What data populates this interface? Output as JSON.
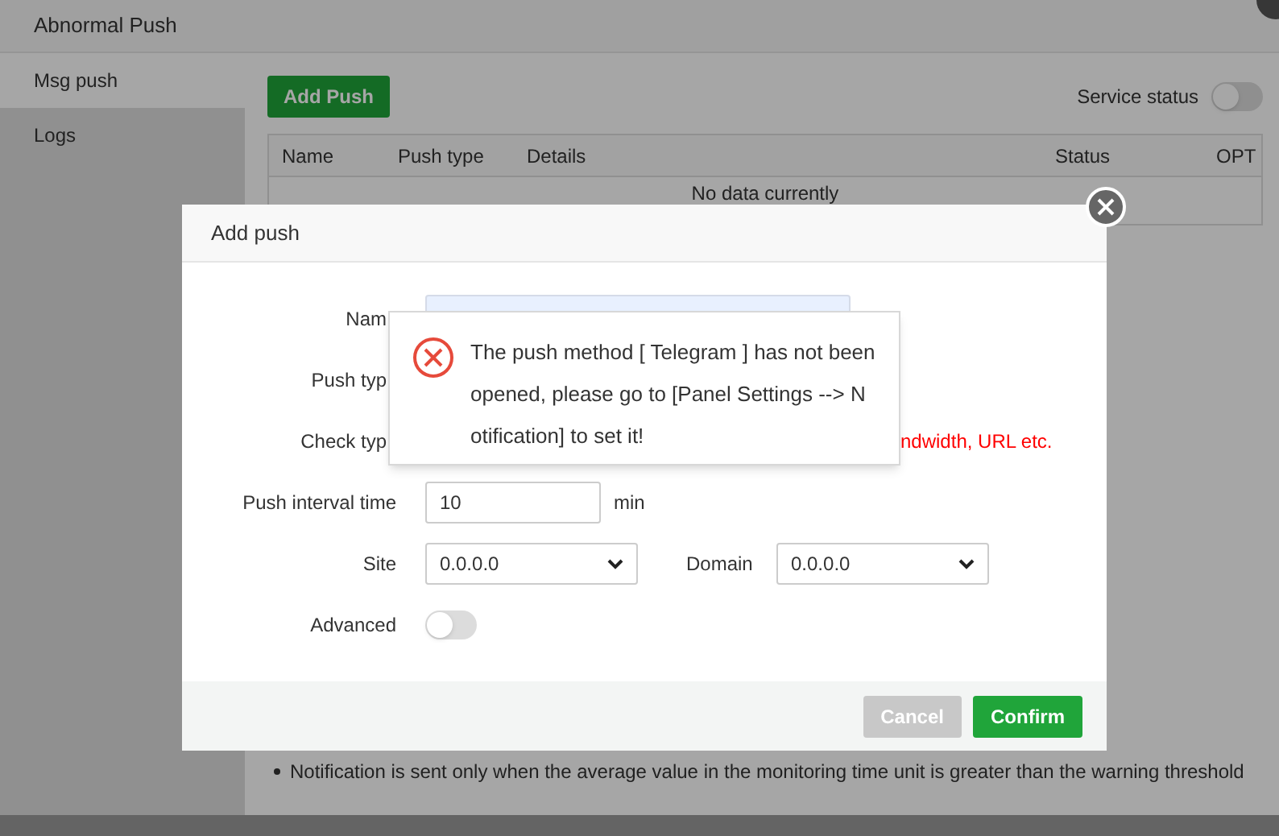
{
  "window": {
    "title": "Abnormal Push"
  },
  "sidebar": {
    "items": [
      {
        "label": "Msg push",
        "selected": true
      },
      {
        "label": "Logs",
        "selected": false
      }
    ]
  },
  "toolbar": {
    "add_button": "Add Push",
    "service_status": {
      "label": "Service status",
      "on": false
    }
  },
  "table": {
    "columns": [
      "Name",
      "Push type",
      "Details",
      "Status",
      "OPT"
    ],
    "empty_text": "No data currently"
  },
  "note": "Notification is sent only when the average value in the monitoring time unit is greater than the warning threshold",
  "dialog": {
    "title": "Add push",
    "rows": [
      {
        "kind": "input",
        "label": "Nam",
        "value": ""
      },
      {
        "kind": "label",
        "label": "Push typ"
      },
      {
        "kind": "hint",
        "label": "Check typ",
        "hint": "ndwidth, URL etc."
      },
      {
        "kind": "input_unit",
        "label": "Push interval time",
        "value": "10",
        "unit": "min"
      },
      {
        "kind": "selects",
        "label": "Site",
        "value": "0.0.0.0",
        "label_2": "Domain",
        "value_2": "0.0.0.0"
      },
      {
        "kind": "toggle",
        "label": "Advanced",
        "on": false
      }
    ],
    "buttons": [
      {
        "label": "Cancel",
        "disabled": true
      },
      {
        "label": "Confirm",
        "disabled": false
      }
    ]
  },
  "toast": {
    "kind": "error",
    "message": "The push method [ Telegram ] has not been opened, please go to [Panel Settings --> Notification] to set it!"
  }
}
